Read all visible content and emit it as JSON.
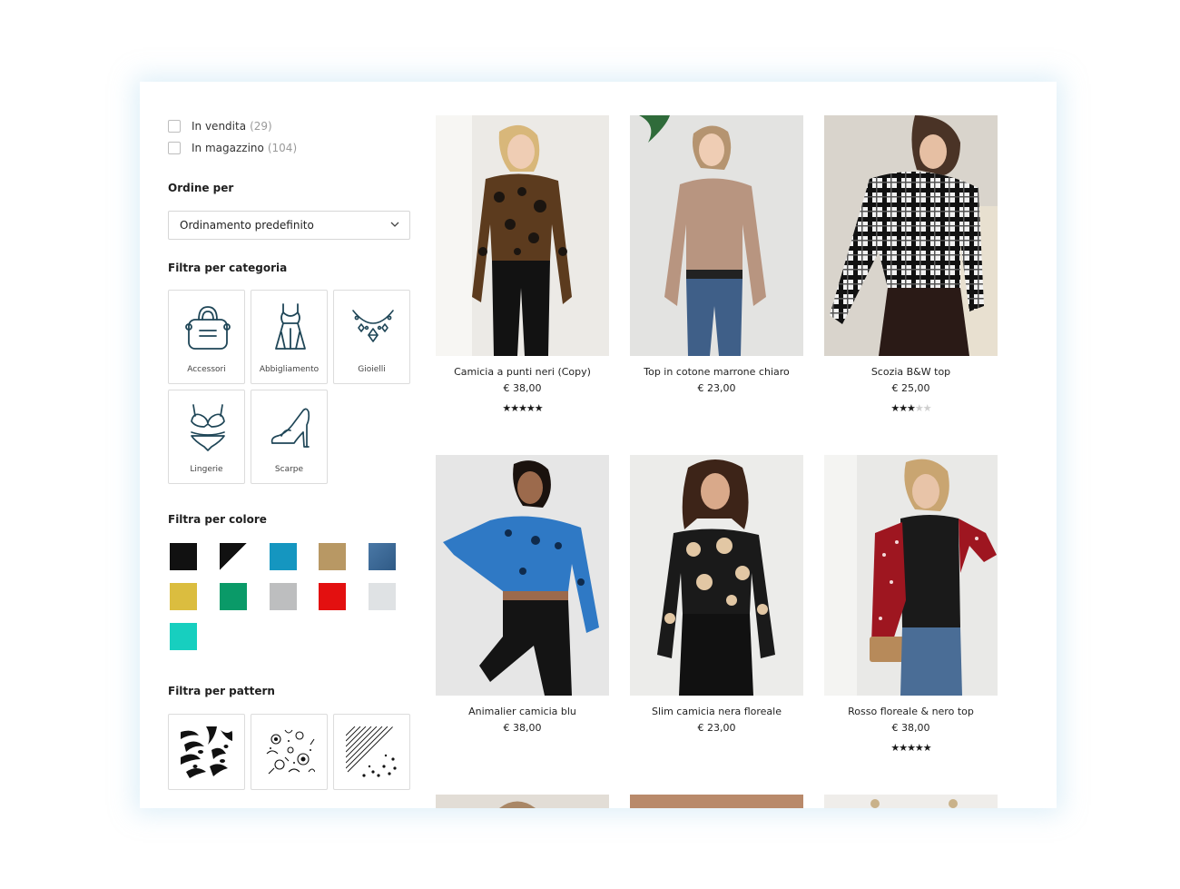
{
  "filters": {
    "availability": [
      {
        "label": "In vendita",
        "count": "(29)"
      },
      {
        "label": "In magazzino",
        "count": "(104)"
      }
    ],
    "sort": {
      "title": "Ordine per",
      "selected": "Ordinamento predefinito"
    },
    "category": {
      "title": "Filtra per categoria",
      "items": [
        {
          "label": "Accessori",
          "icon": "handbag-icon"
        },
        {
          "label": "Abbigliamento",
          "icon": "dress-icon"
        },
        {
          "label": "Gioielli",
          "icon": "necklace-icon"
        },
        {
          "label": "Lingerie",
          "icon": "lingerie-icon"
        },
        {
          "label": "Scarpe",
          "icon": "high-heel-icon"
        }
      ]
    },
    "color": {
      "title": "Filtra per colore",
      "swatches": [
        "#111111",
        "black-white",
        "#1596c0",
        "#b89864",
        "#3e6b99",
        "#dbbd3f",
        "#0a9a68",
        "#bdbebf",
        "#e31010",
        "#dfe2e4",
        "#17cfbf"
      ]
    },
    "pattern": {
      "title": "Filtra per pattern",
      "items": [
        "zebra-pattern-icon",
        "floral-pattern-icon",
        "stripes-dots-pattern-icon"
      ]
    }
  },
  "products": [
    {
      "name": "Camicia a punti neri (Copy)",
      "price": "€ 38,00",
      "rating": 5
    },
    {
      "name": "Top in cotone marrone chiaro",
      "price": "€ 23,00",
      "rating": 0
    },
    {
      "name": "Scozia B&W top",
      "price": "€ 25,00",
      "rating": 3
    },
    {
      "name": "Animalier camicia blu",
      "price": "€ 38,00",
      "rating": 0
    },
    {
      "name": "Slim camicia nera floreale",
      "price": "€ 23,00",
      "rating": 0
    },
    {
      "name": "Rosso floreale & nero top",
      "price": "€ 38,00",
      "rating": 5
    }
  ],
  "colors": {
    "icon_stroke": "#1f4657",
    "border": "#dcdcdc"
  }
}
